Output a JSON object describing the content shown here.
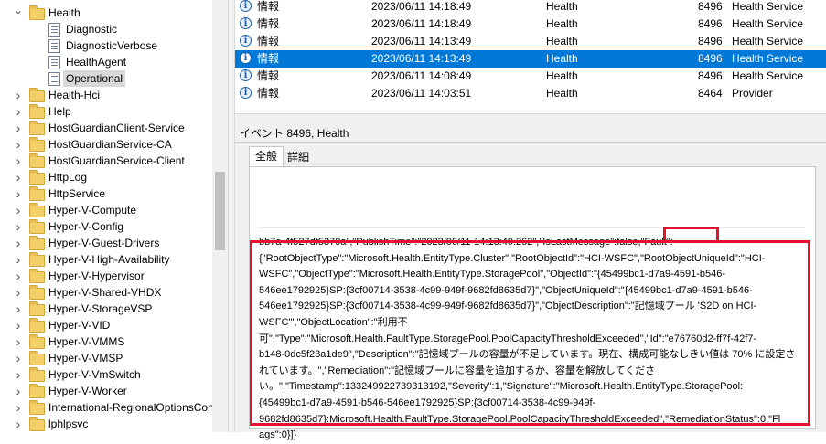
{
  "tree": {
    "items": [
      {
        "label": "Health",
        "level": 0,
        "expanded": true,
        "icon": "folder-icon"
      },
      {
        "label": "Diagnostic",
        "level": 1,
        "icon": "log-icon"
      },
      {
        "label": "DiagnosticVerbose",
        "level": 1,
        "icon": "log-icon"
      },
      {
        "label": "HealthAgent",
        "level": 1,
        "icon": "log-icon"
      },
      {
        "label": "Operational",
        "level": 1,
        "icon": "log-icon",
        "selected": true
      },
      {
        "label": "Health-Hci",
        "level": 0,
        "icon": "folder-icon"
      },
      {
        "label": "Help",
        "level": 0,
        "icon": "folder-icon"
      },
      {
        "label": "HostGuardianClient-Service",
        "level": 0,
        "icon": "folder-icon"
      },
      {
        "label": "HostGuardianService-CA",
        "level": 0,
        "icon": "folder-icon"
      },
      {
        "label": "HostGuardianService-Client",
        "level": 0,
        "icon": "folder-icon"
      },
      {
        "label": "HttpLog",
        "level": 0,
        "icon": "folder-icon"
      },
      {
        "label": "HttpService",
        "level": 0,
        "icon": "folder-icon"
      },
      {
        "label": "Hyper-V-Compute",
        "level": 0,
        "icon": "folder-icon"
      },
      {
        "label": "Hyper-V-Config",
        "level": 0,
        "icon": "folder-icon"
      },
      {
        "label": "Hyper-V-Guest-Drivers",
        "level": 0,
        "icon": "folder-icon"
      },
      {
        "label": "Hyper-V-High-Availability",
        "level": 0,
        "icon": "folder-icon"
      },
      {
        "label": "Hyper-V-Hypervisor",
        "level": 0,
        "icon": "folder-icon"
      },
      {
        "label": "Hyper-V-Shared-VHDX",
        "level": 0,
        "icon": "folder-icon"
      },
      {
        "label": "Hyper-V-StorageVSP",
        "level": 0,
        "icon": "folder-icon"
      },
      {
        "label": "Hyper-V-VID",
        "level": 0,
        "icon": "folder-icon"
      },
      {
        "label": "Hyper-V-VMMS",
        "level": 0,
        "icon": "folder-icon"
      },
      {
        "label": "Hyper-V-VMSP",
        "level": 0,
        "icon": "folder-icon"
      },
      {
        "label": "Hyper-V-VmSwitch",
        "level": 0,
        "icon": "folder-icon"
      },
      {
        "label": "Hyper-V-Worker",
        "level": 0,
        "icon": "folder-icon"
      },
      {
        "label": "International-RegionalOptionsCon",
        "level": 0,
        "icon": "folder-icon"
      },
      {
        "label": "lphlpsvc",
        "level": 0,
        "icon": "folder-icon"
      }
    ]
  },
  "events": {
    "rows": [
      {
        "level": "情報",
        "date": "2023/06/11 14:18:49",
        "source": "Health",
        "id": "8496",
        "category": "Health Service",
        "selected": false
      },
      {
        "level": "情報",
        "date": "2023/06/11 14:18:49",
        "source": "Health",
        "id": "8496",
        "category": "Health Service",
        "selected": false
      },
      {
        "level": "情報",
        "date": "2023/06/11 14:13:49",
        "source": "Health",
        "id": "8496",
        "category": "Health Service",
        "selected": false
      },
      {
        "level": "情報",
        "date": "2023/06/11 14:13:49",
        "source": "Health",
        "id": "8496",
        "category": "Health Service",
        "selected": true
      },
      {
        "level": "情報",
        "date": "2023/06/11 14:08:49",
        "source": "Health",
        "id": "8496",
        "category": "Health Service",
        "selected": false
      },
      {
        "level": "情報",
        "date": "2023/06/11 14:03:51",
        "source": "Health",
        "id": "8464",
        "category": "Provider",
        "selected": false
      }
    ],
    "selected_color": "#0078d7"
  },
  "detail": {
    "title": "イベント 8496, Health",
    "tabs": [
      {
        "label": "全般"
      },
      {
        "label": "詳細"
      }
    ],
    "text_lines": [
      "bb7a-4f527df5370a\",\"PublishTime\":\"2023/06/11-14:13:49.262\",\"IsLastMessage\":false,\"Fault\":",
      "{\"RootObjectType\":\"Microsoft.Health.EntityType.Cluster\",\"RootObjectId\":\"HCI-WSFC\",\"RootObjectUniqueId\":\"HCI-",
      "WSFC\",\"ObjectType\":\"Microsoft.Health.EntityType.StoragePool\",\"ObjectId\":\"{45499bc1-d7a9-4591-b546-",
      "546ee1792925}SP:{3cf00714-3538-4c99-949f-9682fd8635d7}\",\"ObjectUniqueId\":\"{45499bc1-d7a9-4591-b546-",
      "546ee1792925}SP:{3cf00714-3538-4c99-949f-9682fd8635d7}\",\"ObjectDescription\":\"記憶域プール 'S2D on HCI-",
      "WSFC'\",\"ObjectLocation\":\"利用不",
      "可\",\"Type\":\"Microsoft.Health.FaultType.StoragePool.PoolCapacityThresholdExceeded\",\"Id\":\"e76760d2-ff7f-42f7-",
      "b148-0dc5f23a1de9\",\"Description\":\"記憶域プールの容量が不足しています。現在、構成可能なしきい値は 70% に設定さ",
      "れています。\",\"Remediation\":\"記憶域プールに容量を追加するか、容量を解放してくださ",
      "い。\",\"Timestamp\":133249922739313192,\"Severity\":1,\"Signature\":\"Microsoft.Health.EntityType.StoragePool:",
      "{45499bc1-d7a9-4591-b546-546ee1792925}SP:{3cf00714-3538-4c99-949f-",
      "9682fd8635d7}:Microsoft.Health.FaultType.StoragePool.PoolCapacityThresholdExceeded\",\"RemediationStatus\":0,\"Fl",
      "ags\":0}]}"
    ],
    "highlight_color": "#e8112d"
  }
}
